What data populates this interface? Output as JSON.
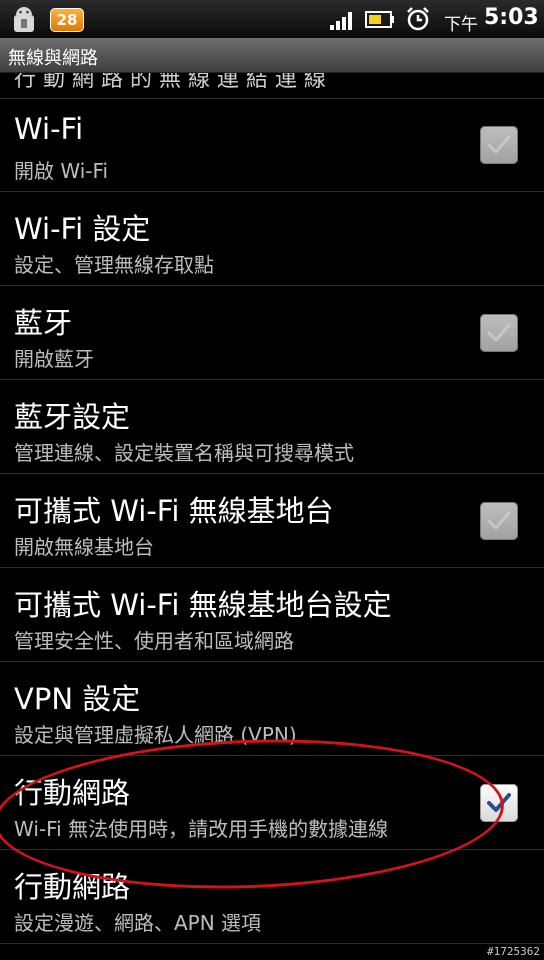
{
  "status_bar": {
    "notification_count": "28",
    "ampm": "下午",
    "time": "5:03",
    "icons": [
      "android-debug-icon",
      "signal-icon",
      "battery-icon",
      "alarm-icon"
    ]
  },
  "title": "無線與網路",
  "cutoff_text": "行 動 網 路 的 無 線 連 結 連 線",
  "items": [
    {
      "title": "Wi-Fi",
      "summary": "開啟 Wi-Fi",
      "checkbox": true,
      "checked": false
    },
    {
      "title": "Wi-Fi 設定",
      "summary": "設定、管理無線存取點",
      "checkbox": false
    },
    {
      "title": "藍牙",
      "summary": "開啟藍牙",
      "checkbox": true,
      "checked": false
    },
    {
      "title": "藍牙設定",
      "summary": "管理連線、設定裝置名稱與可搜尋模式",
      "checkbox": false
    },
    {
      "title": "可攜式 Wi-Fi 無線基地台",
      "summary": "開啟無線基地台",
      "checkbox": true,
      "checked": false
    },
    {
      "title": "可攜式 Wi-Fi 無線基地台設定",
      "summary": "管理安全性、使用者和區域網路",
      "checkbox": false
    },
    {
      "title": "VPN 設定",
      "summary": "設定與管理虛擬私人網路 (VPN)",
      "checkbox": false
    },
    {
      "title": "行動網路",
      "summary": "Wi-Fi 無法使用時，請改用手機的數據連線",
      "checkbox": true,
      "checked": true
    },
    {
      "title": "行動網路",
      "summary": "設定漫遊、網路、APN 選項",
      "checkbox": false
    }
  ],
  "watermark": "#1725362",
  "colors": {
    "check_blue": "#2b4e8c",
    "highlight_red": "#d1141c"
  }
}
